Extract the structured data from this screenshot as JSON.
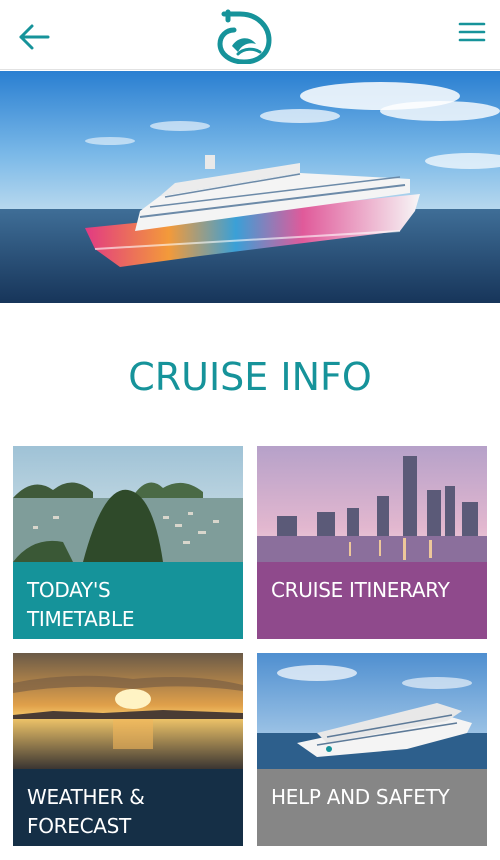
{
  "header": {
    "back_icon": "arrow-left-icon",
    "logo_icon": "cruise-logo-icon",
    "menu_icon": "hamburger-menu-icon",
    "accent_color": "#16939a"
  },
  "hero": {
    "image": "cruise-ship-at-sea"
  },
  "main": {
    "title": "CRUISE INFO",
    "tiles": [
      {
        "label": "TODAY'S TIMETABLE",
        "image": "bay-islands-boats",
        "color": "#15939a"
      },
      {
        "label": "CRUISE ITINERARY",
        "image": "city-skyline-night",
        "color": "#8f4a8c"
      },
      {
        "label": "WEATHER & FORECAST",
        "image": "sunset-over-sea",
        "color": "#152f46"
      },
      {
        "label": "HELP AND SAFETY",
        "image": "cruise-ship",
        "color": "#868686"
      }
    ]
  }
}
